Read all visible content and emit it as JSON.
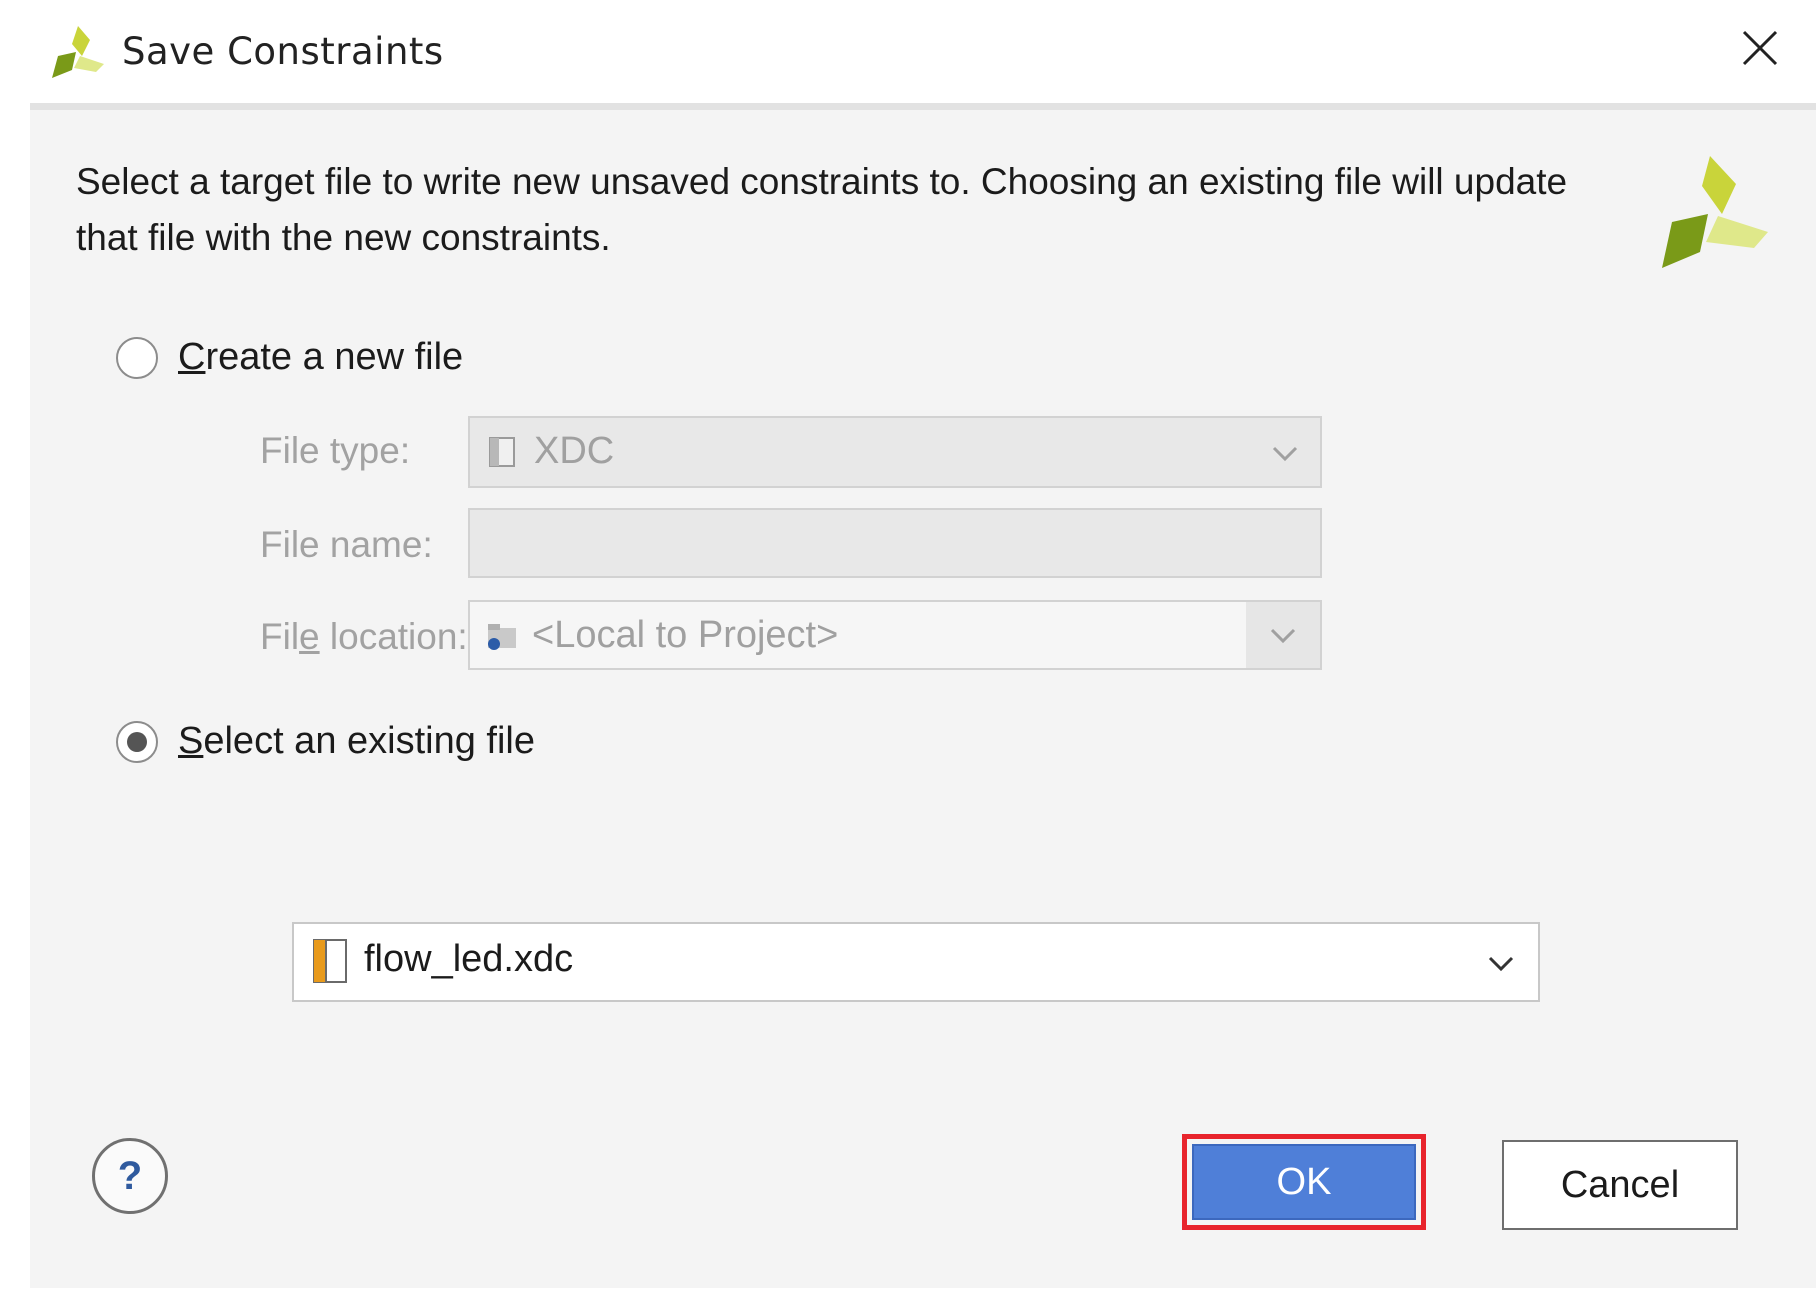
{
  "dialog": {
    "title": "Save Constraints",
    "description_line1": "Select a target file to write new unsaved constraints to. Choosing an existing file will update",
    "description_line2": "that file with the new constraints."
  },
  "create_new": {
    "label_accel": "C",
    "label_rest": "reate a new file",
    "selected": false,
    "file_type_label": "File type:",
    "file_type_value": "XDC",
    "file_name_label": "File name:",
    "file_name_value": "",
    "file_location_label_pre": "Fil",
    "file_location_label_accel": "e",
    "file_location_label_post": " location:",
    "file_location_value": "<Local to Project>"
  },
  "select_existing": {
    "label_accel": "S",
    "label_rest": "elect an existing file",
    "selected": true,
    "file_value": "flow_led.xdc"
  },
  "buttons": {
    "help": "?",
    "ok": "OK",
    "cancel": "Cancel"
  },
  "colors": {
    "ok_button": "#4f7fd8",
    "highlight_box": "#e8242c",
    "logo_green": "#8fae1b",
    "logo_yellow": "#d9e45a"
  },
  "icons": {
    "title_logo": "vivado-logo-icon",
    "close": "close-icon",
    "description_logo": "vivado-logo-icon",
    "file_type": "file-icon",
    "file_location": "folder-icon",
    "existing_file": "constraints-file-icon",
    "dropdown": "chevron-down-icon"
  }
}
